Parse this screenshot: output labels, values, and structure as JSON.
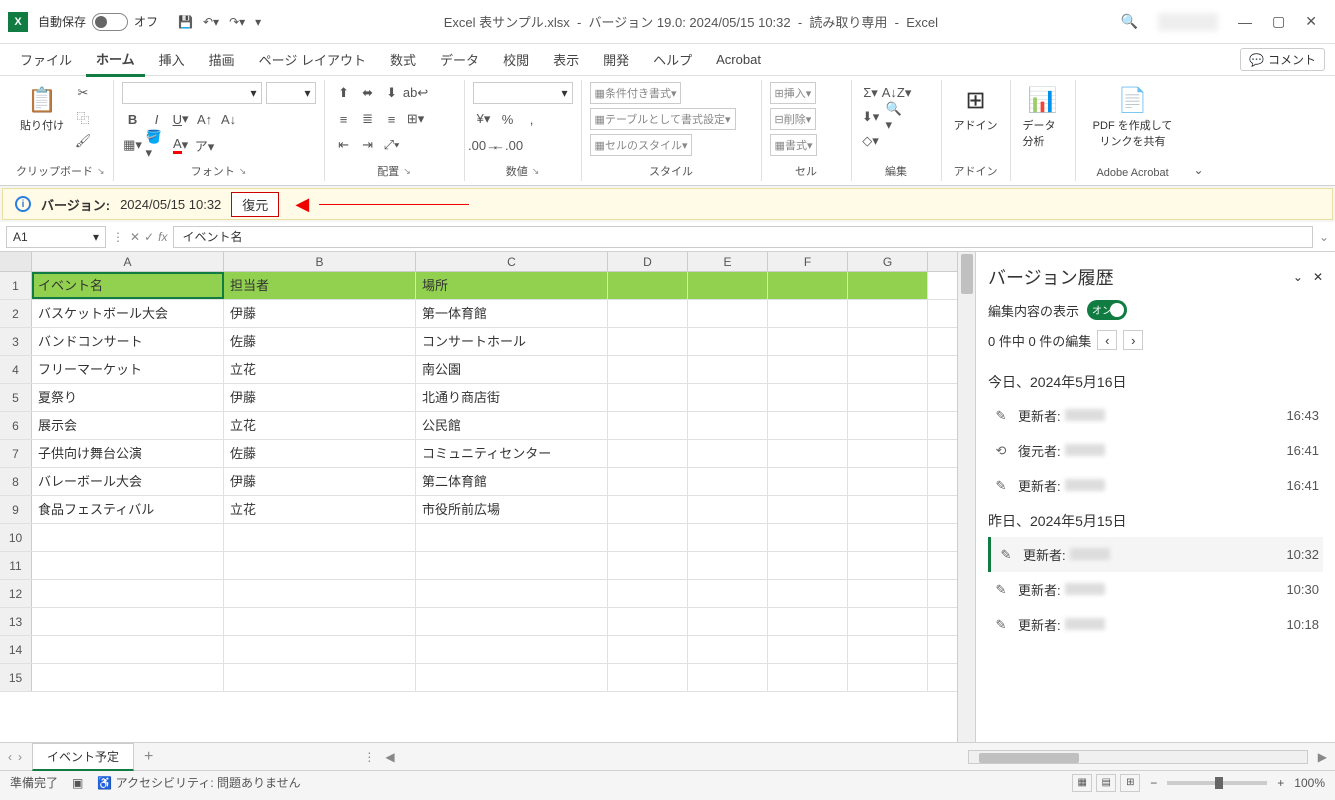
{
  "titlebar": {
    "autosave_label": "自動保存",
    "autosave_state": "オフ",
    "filename": "Excel 表サンプル.xlsx",
    "version_info": "バージョン 19.0: 2024/05/15 10:32",
    "readonly": "読み取り専用",
    "app": "Excel"
  },
  "tabs": {
    "file": "ファイル",
    "home": "ホーム",
    "insert": "挿入",
    "draw": "描画",
    "layout": "ページ レイアウト",
    "formulas": "数式",
    "data": "データ",
    "review": "校閲",
    "view": "表示",
    "developer": "開発",
    "help": "ヘルプ",
    "acrobat": "Acrobat",
    "comment": "コメント"
  },
  "ribbon": {
    "clipboard": {
      "paste": "貼り付け",
      "label": "クリップボード"
    },
    "font": {
      "label": "フォント"
    },
    "align": {
      "label": "配置"
    },
    "number": {
      "label": "数値"
    },
    "styles": {
      "cond": "条件付き書式",
      "table": "テーブルとして書式設定",
      "cell": "セルのスタイル",
      "label": "スタイル"
    },
    "cells": {
      "insert": "挿入",
      "delete": "削除",
      "format": "書式",
      "label": "セル"
    },
    "editing": {
      "label": "編集"
    },
    "addin": {
      "addin": "アドイン",
      "label": "アドイン"
    },
    "analysis": {
      "analysis": "データ分析"
    },
    "acrobat": {
      "pdf": "PDF を作成してリンクを共有",
      "label": "Adobe Acrobat"
    }
  },
  "notice": {
    "version_label": "バージョン:",
    "version_value": "2024/05/15 10:32",
    "restore": "復元"
  },
  "formula": {
    "name_box": "A1",
    "value": "イベント名"
  },
  "columns": [
    "A",
    "B",
    "C",
    "D",
    "E",
    "F",
    "G"
  ],
  "rows": [
    {
      "n": 1,
      "A": "イベント名",
      "B": "担当者",
      "C": "場所",
      "header": true
    },
    {
      "n": 2,
      "A": "バスケットボール大会",
      "B": "伊藤",
      "C": "第一体育館"
    },
    {
      "n": 3,
      "A": "バンドコンサート",
      "B": "佐藤",
      "C": "コンサートホール"
    },
    {
      "n": 4,
      "A": "フリーマーケット",
      "B": "立花",
      "C": "南公園"
    },
    {
      "n": 5,
      "A": "夏祭り",
      "B": "伊藤",
      "C": "北通り商店街"
    },
    {
      "n": 6,
      "A": "展示会",
      "B": "立花",
      "C": "公民館"
    },
    {
      "n": 7,
      "A": "子供向け舞台公演",
      "B": "佐藤",
      "C": "コミュニティセンター"
    },
    {
      "n": 8,
      "A": "バレーボール大会",
      "B": "伊藤",
      "C": "第二体育館"
    },
    {
      "n": 9,
      "A": "食品フェスティバル",
      "B": "立花",
      "C": "市役所前広場"
    },
    {
      "n": 10
    },
    {
      "n": 11
    },
    {
      "n": 12
    },
    {
      "n": 13
    },
    {
      "n": 14
    },
    {
      "n": 15
    }
  ],
  "version_pane": {
    "title": "バージョン履歴",
    "show_edits": "編集内容の表示",
    "toggle_state": "オン",
    "nav_text": "0 件中 0 件の編集",
    "groups": [
      {
        "heading": "今日、2024年5月16日",
        "items": [
          {
            "icon": "pencil",
            "label": "更新者:",
            "time": "16:43"
          },
          {
            "icon": "restore",
            "label": "復元者:",
            "time": "16:41"
          },
          {
            "icon": "pencil",
            "label": "更新者:",
            "time": "16:41"
          }
        ]
      },
      {
        "heading": "昨日、2024年5月15日",
        "items": [
          {
            "icon": "pencil",
            "label": "更新者:",
            "time": "10:32",
            "selected": true
          },
          {
            "icon": "pencil",
            "label": "更新者:",
            "time": "10:30"
          },
          {
            "icon": "pencil",
            "label": "更新者:",
            "time": "10:18"
          }
        ]
      }
    ]
  },
  "sheet": {
    "name": "イベント予定"
  },
  "status": {
    "ready": "準備完了",
    "accessibility": "アクセシビリティ: 問題ありません",
    "zoom": "100%"
  }
}
